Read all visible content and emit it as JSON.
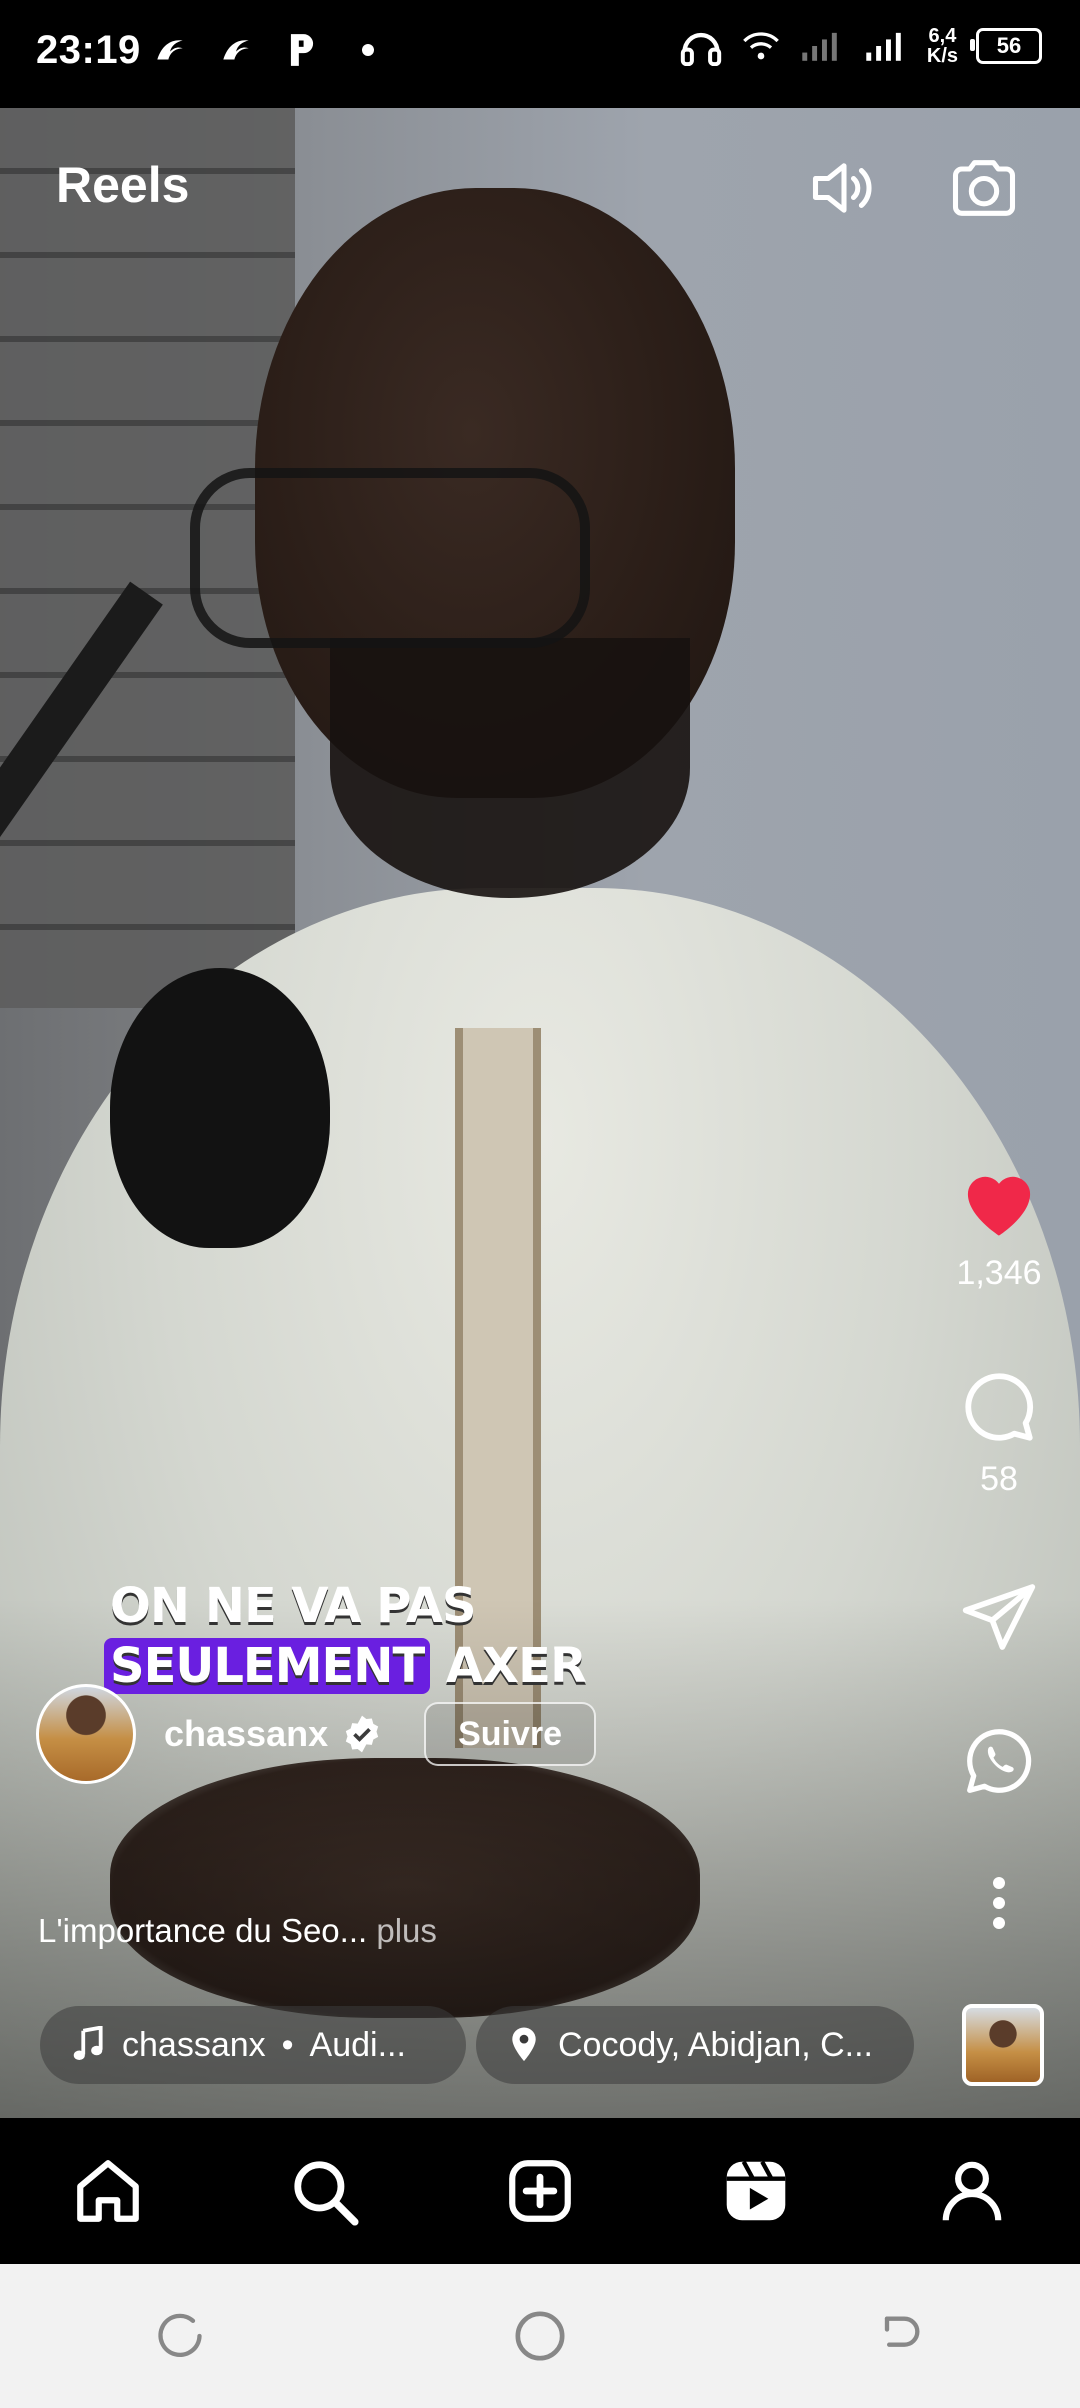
{
  "status_bar": {
    "time": "23:19",
    "left_icons": [
      "threads-icon",
      "threads-icon",
      "p-icon",
      "dot-icon"
    ],
    "net_speed_top": "6,4",
    "net_speed_bottom": "K/s",
    "battery": "56"
  },
  "header": {
    "title": "Reels",
    "icons": [
      "speaker-icon",
      "camera-icon"
    ]
  },
  "caption": {
    "line1": "ON NE VA PAS",
    "line2_highlight": "SEULEMENT",
    "line2_rest": "AXER"
  },
  "right_rail": {
    "like_count": "1,346",
    "comment_count": "58",
    "like_color": "#f02849"
  },
  "author": {
    "username": "chassanx",
    "verified": true,
    "follow_label": "Suivre"
  },
  "description": {
    "text": "L'importance du Seo...",
    "more_label": "plus"
  },
  "audio": {
    "artist": "chassanx",
    "separator": "•",
    "track": "Audi..."
  },
  "location": {
    "label": "Cocody, Abidjan, C..."
  },
  "bottom_nav": [
    "home-icon",
    "search-icon",
    "create-icon",
    "reels-icon",
    "profile-icon"
  ],
  "system_nav": [
    "recents-icon",
    "home-circle-icon",
    "back-icon"
  ]
}
